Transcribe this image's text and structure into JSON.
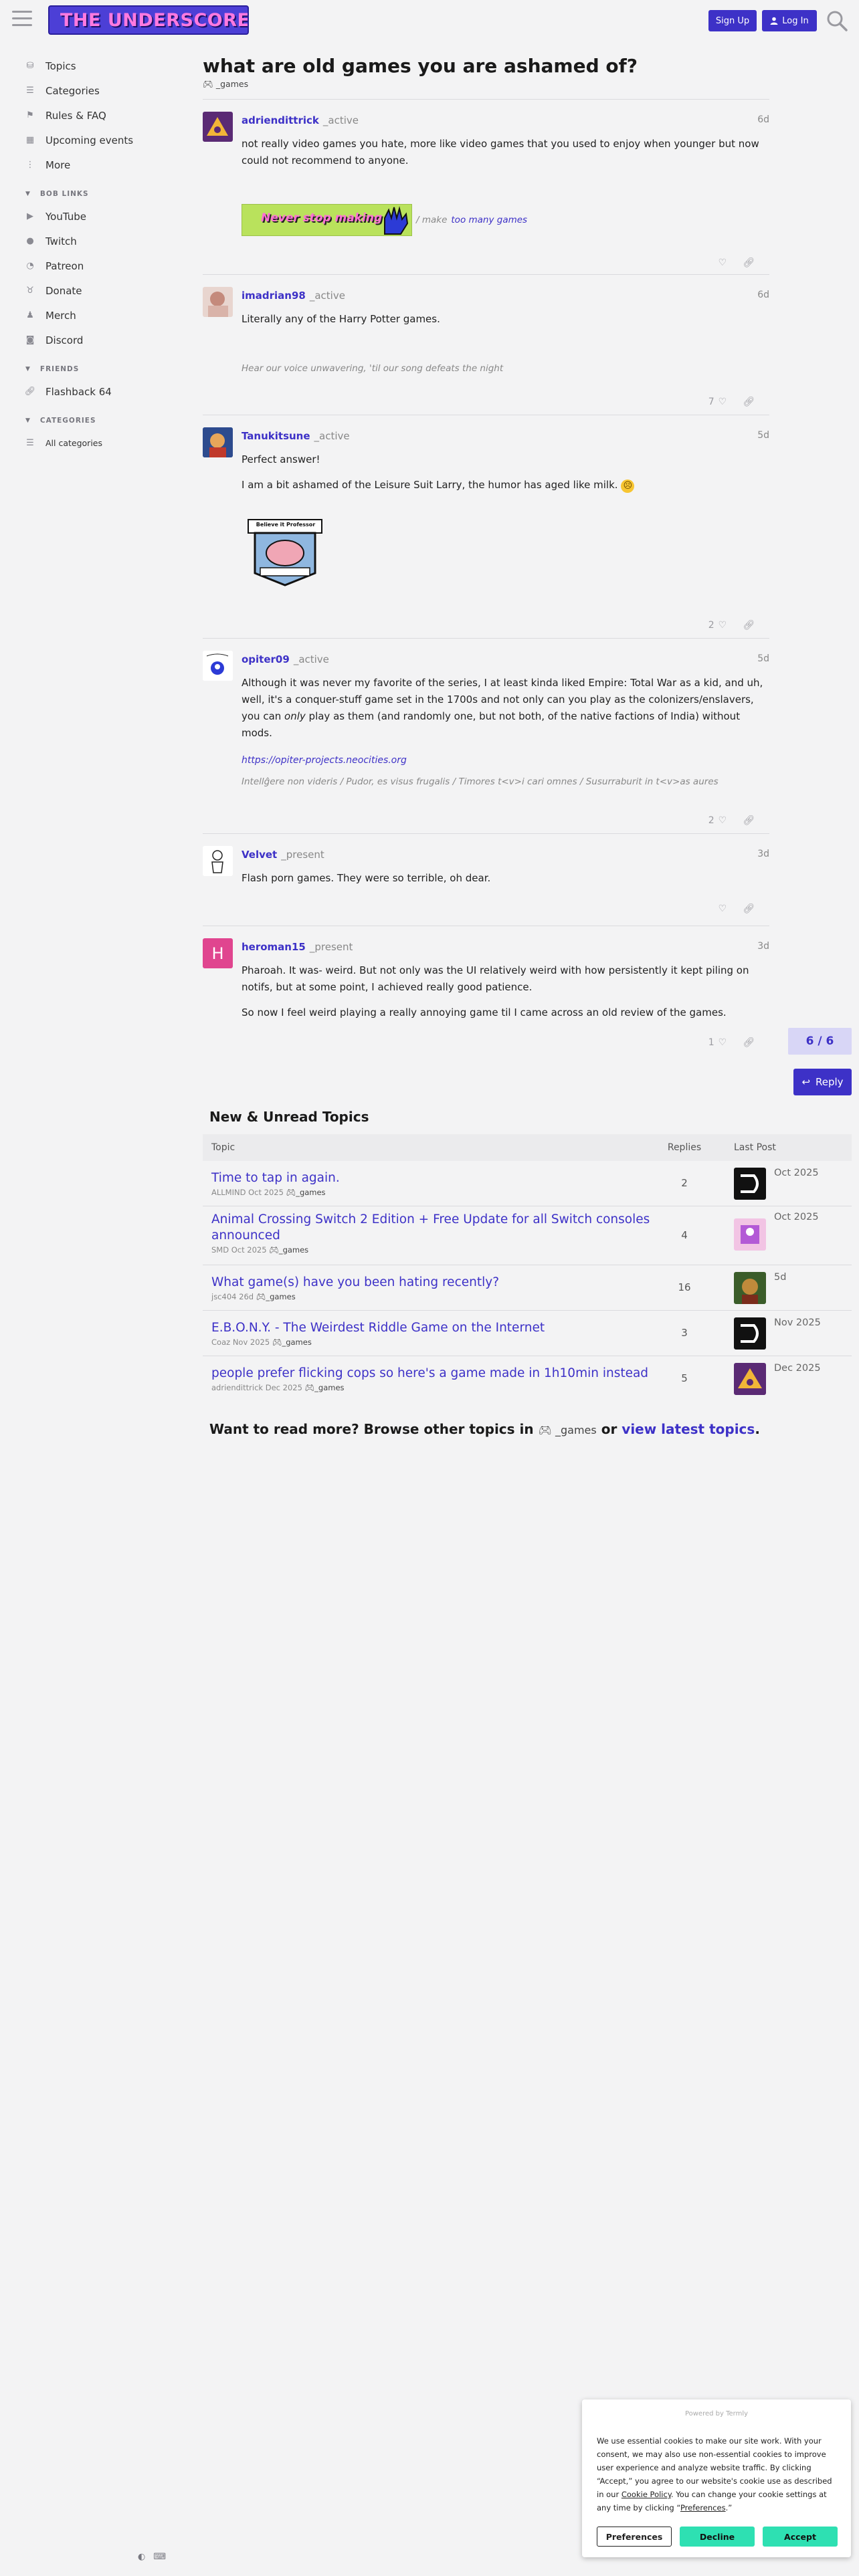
{
  "header": {
    "logo_text": "THE UNDERSCORE",
    "signup_label": "Sign Up",
    "login_label": "Log In"
  },
  "sidebar": {
    "items": [
      {
        "label": "Topics",
        "icon": "topics-icon"
      },
      {
        "label": "Categories",
        "icon": "list-icon"
      },
      {
        "label": "Rules & FAQ",
        "icon": "flag-icon"
      },
      {
        "label": "Upcoming events",
        "icon": "calendar-icon"
      },
      {
        "label": "More",
        "icon": "more-icon"
      }
    ],
    "section_links": "BOB LINKS",
    "links": [
      {
        "label": "YouTube",
        "icon": "play-icon"
      },
      {
        "label": "Twitch",
        "icon": "twitch-icon"
      },
      {
        "label": "Patreon",
        "icon": "patreon-icon"
      },
      {
        "label": "Donate",
        "icon": "donate-icon"
      },
      {
        "label": "Merch",
        "icon": "shirt-icon"
      },
      {
        "label": "Discord",
        "icon": "discord-icon"
      }
    ],
    "section_friends": "FRIENDS",
    "friends": [
      {
        "label": "Flashback 64",
        "icon": "link-icon"
      }
    ],
    "section_categories": "CATEGORIES",
    "categories": [
      {
        "label": "All categories",
        "icon": "list-icon"
      }
    ]
  },
  "topic": {
    "title": "what are old games you are ashamed of?",
    "category": "_games"
  },
  "posts": [
    {
      "username": "adriendittrick",
      "user_title": "_active",
      "date": "6d",
      "body": [
        "not really video games you hate, more like video games that you used to enjoy when younger but now could not recommend to anyone."
      ],
      "sig_prefix": "/ make",
      "sig_link": "too many games",
      "banner_text": "Never stop making",
      "likes": "",
      "avatar_color": "#5a2a74"
    },
    {
      "username": "imadrian98",
      "user_title": "_active",
      "date": "6d",
      "body": [
        "Literally any of the Harry Potter games."
      ],
      "sig": "Hear our voice unwavering, 'til our song defeats the night",
      "likes": "7",
      "avatar_color": "#d9b3a9"
    },
    {
      "username": "Tanukitsune",
      "user_title": "_active",
      "date": "5d",
      "body": [
        "Perfect answer!",
        "I am a bit ashamed of the Leisure Suit Larry, the humor has aged like milk."
      ],
      "badge_text": "Believe it Professor",
      "likes": "2",
      "avatar_color": "#3a5aa8"
    },
    {
      "username": "opiter09",
      "user_title": "_active",
      "date": "5d",
      "body_before": "Although it was never my favorite of the series, I at least kinda liked Empire: Total War as a kid, and uh, well, it's a conquer-stuff game set in the 1700s and not only can you play as the colonizers/enslavers, you can ",
      "body_em": "only",
      "body_after": " play as them (and randomly one, but not both, of the native factions of India) without mods.",
      "link": "https://opiter-projects.neocities.org",
      "sig": "Intellĝere non videris / Pudor, es visus frugalis / Timores t<v>i cari omnes / Susurraburit in t<v>as aures",
      "likes": "2",
      "avatar_color": "#ffffff"
    },
    {
      "username": "Velvet",
      "user_title": "_present",
      "date": "3d",
      "body": [
        "Flash porn games. They were so terrible, oh dear."
      ],
      "likes": "",
      "avatar_color": "#ffffff"
    },
    {
      "username": "heroman15",
      "user_title": "_present",
      "date": "3d",
      "avatar_letter": "H",
      "body": [
        "Pharoah. It was- weird. But not only was the UI relatively weird with how persistently it kept piling on notifs, but at some point, I achieved really good patience.",
        "So now I feel weird playing a really annoying game til I came across an old review of the games."
      ],
      "likes": "1",
      "avatar_color": "#e0458f"
    }
  ],
  "timeline": "6 / 6",
  "reply_label": "Reply",
  "suggested": {
    "title": "New & Unread Topics",
    "headers": {
      "topic": "Topic",
      "replies": "Replies",
      "last_post": "Last Post"
    },
    "rows": [
      {
        "title": "Time to tap in again.",
        "author": "ALLMIND",
        "when": "Oct 2025",
        "category": "_games",
        "replies": "2",
        "last": "Oct 2025",
        "av": "dark"
      },
      {
        "title": "Animal Crossing Switch 2 Edition + Free Update for all Switch consoles announced",
        "author": "SMD",
        "when": "Oct 2025",
        "category": "_games",
        "replies": "4",
        "last": "Oct 2025",
        "av": "pink"
      },
      {
        "title": "What game(s) have you been hating recently?",
        "author": "jsc404",
        "when": "26d",
        "category": "_games",
        "replies": "16",
        "last": "5d",
        "av": "green"
      },
      {
        "title": "E.B.O.N.Y. - The Weirdest Riddle Game on the Internet",
        "author": "Coaz",
        "when": "Nov 2025",
        "category": "_games",
        "replies": "3",
        "last": "Nov 2025",
        "av": "dark"
      },
      {
        "title": "people prefer flicking cops so here's a game made in 1h10min instead",
        "author": "adriendittrick",
        "when": "Dec 2025",
        "category": "_games",
        "replies": "5",
        "last": "Dec 2025",
        "av": "purple"
      }
    ]
  },
  "more_topics": {
    "prefix": "Want to read more? Browse other topics in",
    "category": "_games",
    "middle": "or",
    "link": "view latest topics",
    "suffix": "."
  },
  "cookie": {
    "powered": "Powered by Termly",
    "text_1": "We use essential cookies to make our site work. With your consent, we may also use non-essential cookies to improve user experience and analyze website traffic. By clicking “Accept,” you agree to our website's cookie use as described in our ",
    "policy_link": "Cookie Policy",
    "text_2": ". You can change your cookie settings at any time by clicking “",
    "prefs_link": "Preferences",
    "text_3": ".”",
    "btn_preferences": "Preferences",
    "btn_decline": "Decline",
    "btn_accept": "Accept"
  },
  "colors": {
    "accent": "#3d31c7",
    "cookie_green": "#2ee0b2",
    "background": "#f3f3f4"
  }
}
